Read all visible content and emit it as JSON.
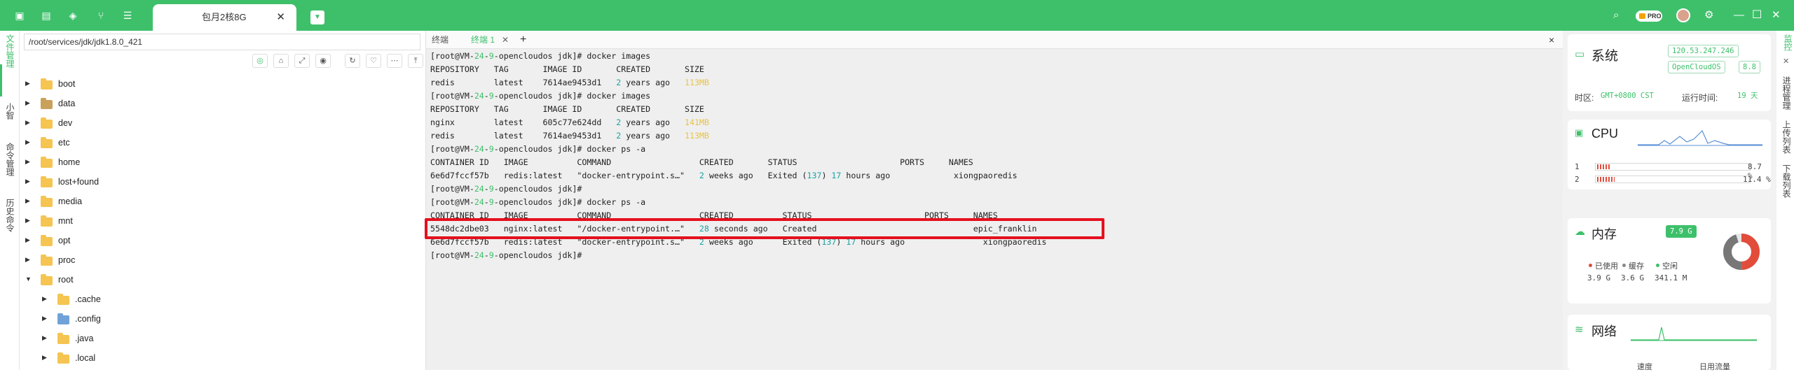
{
  "window": {
    "tab_title": "包月2核8G",
    "pro_badge": "PRO"
  },
  "left_strip": {
    "items": [
      "文件管理",
      "小智",
      "命令管理",
      "历史命令"
    ]
  },
  "file_panel": {
    "path": "/root/services/jdk/jdk1.8.0_421",
    "tree": [
      {
        "name": "boot",
        "level": 0,
        "expanded": false,
        "icon": "folder"
      },
      {
        "name": "data",
        "level": 0,
        "expanded": false,
        "icon": "folder-special"
      },
      {
        "name": "dev",
        "level": 0,
        "expanded": false,
        "icon": "folder"
      },
      {
        "name": "etc",
        "level": 0,
        "expanded": false,
        "icon": "folder"
      },
      {
        "name": "home",
        "level": 0,
        "expanded": false,
        "icon": "folder"
      },
      {
        "name": "lost+found",
        "level": 0,
        "expanded": false,
        "icon": "folder"
      },
      {
        "name": "media",
        "level": 0,
        "expanded": false,
        "icon": "folder"
      },
      {
        "name": "mnt",
        "level": 0,
        "expanded": false,
        "icon": "folder"
      },
      {
        "name": "opt",
        "level": 0,
        "expanded": false,
        "icon": "folder"
      },
      {
        "name": "proc",
        "level": 0,
        "expanded": false,
        "icon": "folder"
      },
      {
        "name": "root",
        "level": 0,
        "expanded": true,
        "icon": "folder"
      },
      {
        "name": ".cache",
        "level": 1,
        "expanded": false,
        "icon": "folder"
      },
      {
        "name": ".config",
        "level": 1,
        "expanded": false,
        "icon": "folder-config"
      },
      {
        "name": ".java",
        "level": 1,
        "expanded": false,
        "icon": "folder"
      },
      {
        "name": ".local",
        "level": 1,
        "expanded": false,
        "icon": "folder"
      }
    ]
  },
  "terminal": {
    "tabs": [
      {
        "label": "终端",
        "active": false
      },
      {
        "label": "终端 1",
        "active": true
      }
    ],
    "add_tab": "+",
    "close": "×",
    "lines": [
      [
        "[root@VM-",
        {
          "c": "g",
          "t": "24"
        },
        "-",
        {
          "c": "g",
          "t": "9"
        },
        "-opencloudos jdk]# docker images"
      ],
      [
        "REPOSITORY   TAG       IMAGE ID       CREATED       SIZE"
      ],
      [
        "redis        latest    7614ae9453d1   ",
        {
          "c": "c",
          "t": "2"
        },
        " years ago   ",
        {
          "c": "y",
          "t": "113MB"
        }
      ],
      [
        "[root@VM-",
        {
          "c": "g",
          "t": "24"
        },
        "-",
        {
          "c": "g",
          "t": "9"
        },
        "-opencloudos jdk]# docker images"
      ],
      [
        "REPOSITORY   TAG       IMAGE ID       CREATED       SIZE"
      ],
      [
        "nginx        latest    605c77e624dd   ",
        {
          "c": "c",
          "t": "2"
        },
        " years ago   ",
        {
          "c": "y",
          "t": "141MB"
        }
      ],
      [
        "redis        latest    7614ae9453d1   ",
        {
          "c": "c",
          "t": "2"
        },
        " years ago   ",
        {
          "c": "y",
          "t": "113MB"
        }
      ],
      [
        "[root@VM-",
        {
          "c": "g",
          "t": "24"
        },
        "-",
        {
          "c": "g",
          "t": "9"
        },
        "-opencloudos jdk]# docker ps -a"
      ],
      [
        "CONTAINER ID   IMAGE          COMMAND                  CREATED       STATUS                     PORTS     NAMES"
      ],
      [
        "6e6d7fccf57b   redis:latest   \"docker-entrypoint.s…\"   ",
        {
          "c": "c",
          "t": "2"
        },
        " weeks ago   Exited (",
        {
          "c": "c",
          "t": "137"
        },
        ") ",
        {
          "c": "c",
          "t": "17"
        },
        " hours ago             xiongpaoredis"
      ],
      [
        "[root@VM-",
        {
          "c": "g",
          "t": "24"
        },
        "-",
        {
          "c": "g",
          "t": "9"
        },
        "-opencloudos jdk]#"
      ],
      [
        "[root@VM-",
        {
          "c": "g",
          "t": "24"
        },
        "-",
        {
          "c": "g",
          "t": "9"
        },
        "-opencloudos jdk]# docker ps -a"
      ],
      [
        "CONTAINER ID   IMAGE          COMMAND                  CREATED          STATUS                       PORTS     NAMES"
      ],
      [
        "5548dc2dbe03   nginx:latest   \"/docker-entrypoint.…\"   ",
        {
          "c": "c",
          "t": "28"
        },
        " seconds ago   Created                                epic_franklin"
      ],
      [
        "6e6d7fccf57b   redis:latest   \"docker-entrypoint.s…\"   ",
        {
          "c": "c",
          "t": "2"
        },
        " weeks ago      Exited (",
        {
          "c": "c",
          "t": "137"
        },
        ") ",
        {
          "c": "c",
          "t": "17"
        },
        " hours ago                xiongpaoredis"
      ],
      [
        "[root@VM-",
        {
          "c": "g",
          "t": "24"
        },
        "-",
        {
          "c": "g",
          "t": "9"
        },
        "-opencloudos jdk]#"
      ]
    ]
  },
  "system": {
    "title": "系统",
    "ip": "120.53.247.246",
    "os": "OpenCloudOS",
    "version": "8.8",
    "tz_label": "时区:",
    "tz_value": "GMT+0800 CST",
    "uptime_label": "运行时间:",
    "uptime_value": "19 天"
  },
  "cpu": {
    "title": "CPU",
    "cores": [
      {
        "id": "1",
        "usage_pct": 8.7,
        "label": "8.7 %"
      },
      {
        "id": "2",
        "usage_pct": 11.4,
        "label": "11.4 %"
      }
    ]
  },
  "memory": {
    "title": "内存",
    "total": "7.9 G",
    "legend": [
      {
        "label": "已使用",
        "value": "3.9 G",
        "color": "#e24c3b"
      },
      {
        "label": "缓存",
        "value": "3.6 G",
        "color": "#888888"
      },
      {
        "label": "空闲",
        "value": "341.1 M",
        "color": "#3ec06b"
      }
    ]
  },
  "network": {
    "title": "网络",
    "down_label": "速度",
    "flow_label": "日用流量"
  },
  "right_strip": {
    "items": [
      "监控",
      "进程管理",
      "上传列表",
      "下载列表"
    ]
  },
  "colors": {
    "accent": "#3ec06b",
    "highlight": "#e5101e"
  },
  "icons": [
    "terminal-icon",
    "file-icon",
    "layers-icon",
    "fork-icon",
    "list-icon",
    "search-icon",
    "pro-badge-icon",
    "avatar",
    "settings-icon",
    "minimize-icon",
    "maximize-icon",
    "close-icon"
  ]
}
